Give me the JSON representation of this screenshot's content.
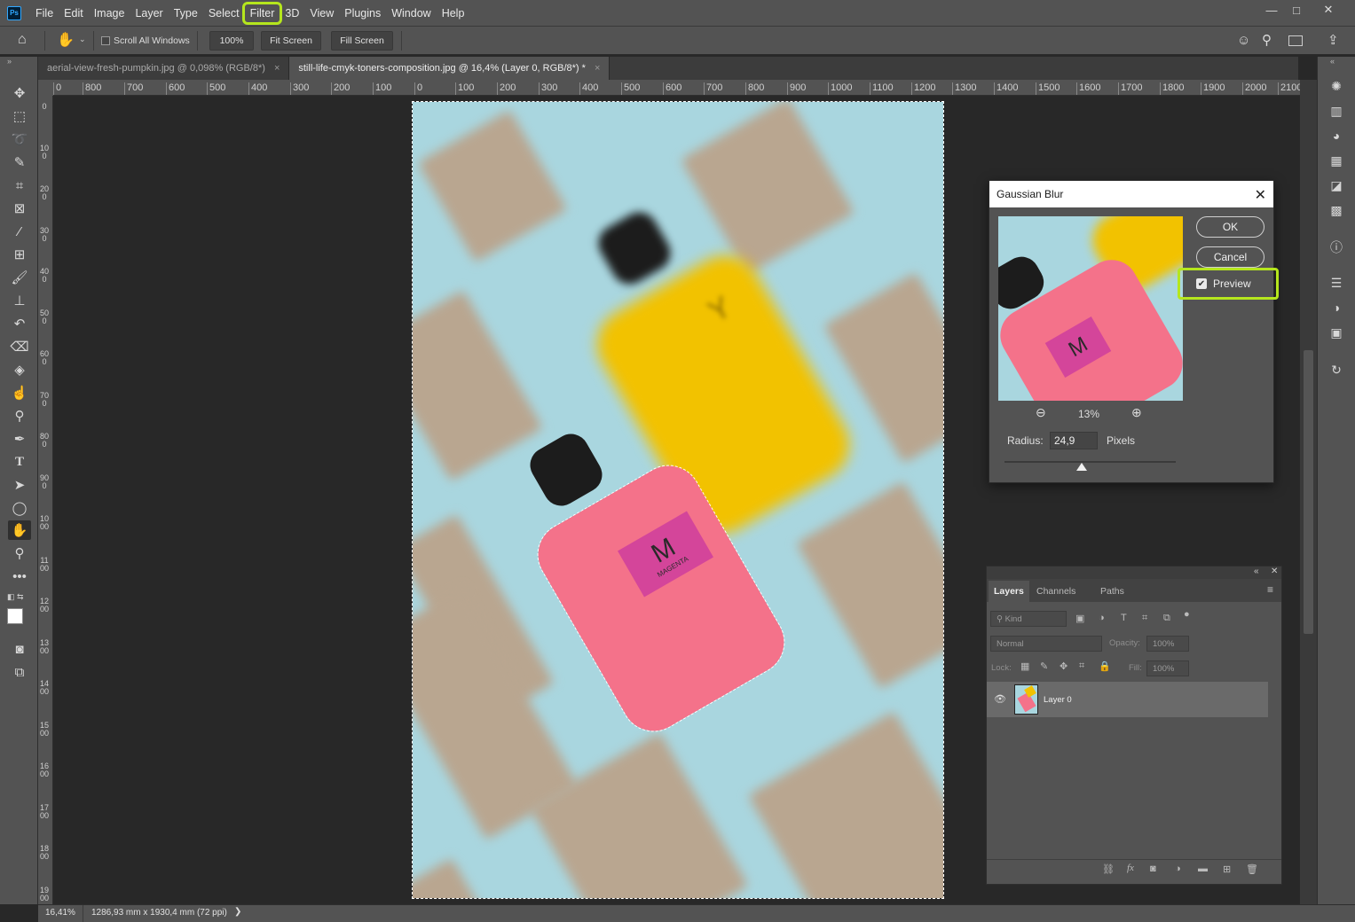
{
  "app": {
    "logo": "Ps"
  },
  "menu": [
    "File",
    "Edit",
    "Image",
    "Layer",
    "Type",
    "Select",
    "Filter",
    "3D",
    "View",
    "Plugins",
    "Window",
    "Help"
  ],
  "options": {
    "scroll_all_windows": "Scroll All Windows",
    "zoom_100": "100%",
    "fit_screen": "Fit Screen",
    "fill_screen": "Fill Screen"
  },
  "tabs": [
    {
      "label": "aerial-view-fresh-pumpkin.jpg @ 0,098% (RGB/8*)",
      "close": "×"
    },
    {
      "label": "still-life-cmyk-toners-composition.jpg @ 16,4% (Layer 0, RGB/8*) *",
      "close": "×"
    }
  ],
  "ruler_top": [
    "0",
    "800",
    "700",
    "600",
    "500",
    "400",
    "300",
    "200",
    "100",
    "0",
    "100",
    "200",
    "300",
    "400",
    "500",
    "600",
    "700",
    "800",
    "900",
    "1000",
    "1100",
    "1200",
    "1300",
    "1400",
    "1500",
    "1600",
    "1700",
    "1800",
    "1900",
    "2000",
    "2100"
  ],
  "ruler_left": [
    "0",
    "100",
    "200",
    "300",
    "400",
    "500",
    "600",
    "700",
    "800",
    "900",
    "1000",
    "1100",
    "1200",
    "1300",
    "1400",
    "1500",
    "1600",
    "1700",
    "1800",
    "1900"
  ],
  "photo": {
    "label_letter": "M",
    "label_text": "MAGENTA",
    "yellow_letter": "Y"
  },
  "status": {
    "zoom": "16,41%",
    "doc_size": "1286,93 mm x 1930,4 mm (72 ppi)",
    "arrow": "❯"
  },
  "gaussian_blur": {
    "title": "Gaussian Blur",
    "ok": "OK",
    "cancel": "Cancel",
    "preview_label": "Preview",
    "preview_checked": true,
    "zoom": "13%",
    "radius_label": "Radius:",
    "radius_value": "24,9",
    "radius_unit": "Pixels"
  },
  "layers": {
    "tabs": [
      "Layers",
      "Channels",
      "Paths"
    ],
    "kind": "Kind",
    "blend_mode": "Normal",
    "opacity_label": "Opacity:",
    "opacity_value": "100%",
    "lock_label": "Lock:",
    "fill_label": "Fill:",
    "fill_value": "100%",
    "layer_name": "Layer 0"
  },
  "colors": {
    "accent_highlight": "#b5e61d",
    "ps_blue": "#31a8ff"
  }
}
